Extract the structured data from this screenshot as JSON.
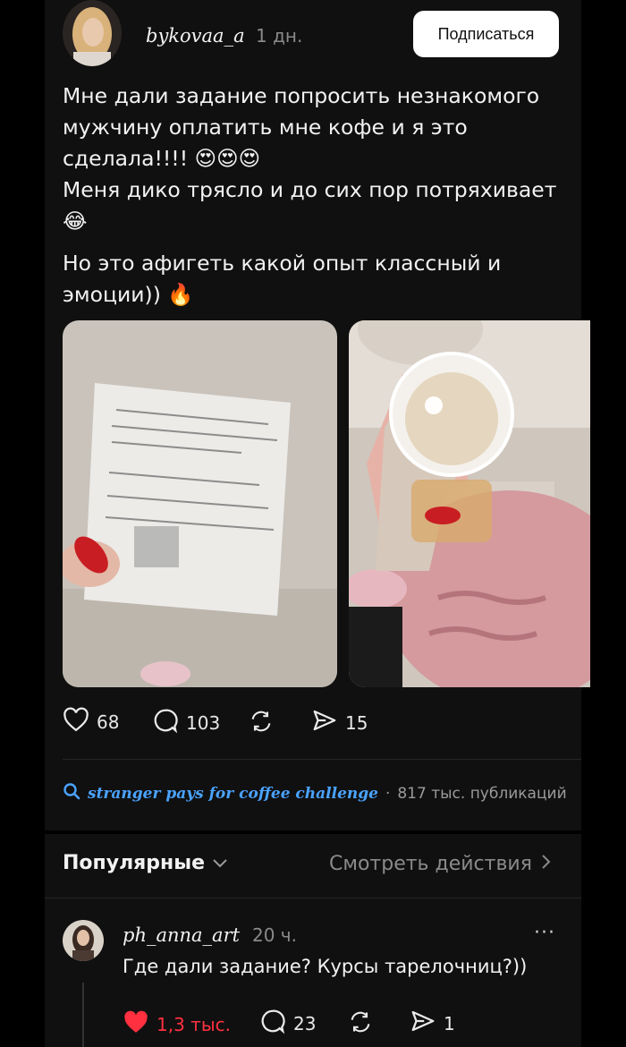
{
  "post": {
    "username": "bykovaa_a",
    "time": "1 дн.",
    "subscribe_label": "Подписаться",
    "text_1": "Мне дали задание попросить незнакомого мужчину оплатить мне кофе и я это сделала!!!! 😍😍😍",
    "text_2": "Меня дико трясло и до сих пор потряхивает 😂",
    "text_3": "Но это афигеть какой опыт классный и эмоции)) 🔥",
    "likes": "68",
    "comments": "103",
    "reposts": "",
    "shares": "15"
  },
  "hashtag": {
    "tag": "stranger pays for coffee challenge",
    "separator": "·",
    "count": "817 тыс. публикаций"
  },
  "comments_header": {
    "sort_label": "Популярные",
    "view_label": "Смотреть действия"
  },
  "comment": {
    "username": "ph_anna_art",
    "time": "20 ч.",
    "more": "···",
    "text": "Где дали задание? Курсы тарелочниц?))",
    "likes": "1,3 тыс.",
    "replies": "23",
    "shares": "1"
  },
  "colors": {
    "background": "#101010",
    "link": "#4aa3ff",
    "like_active": "#ff3040",
    "muted": "#8a8a8a"
  }
}
